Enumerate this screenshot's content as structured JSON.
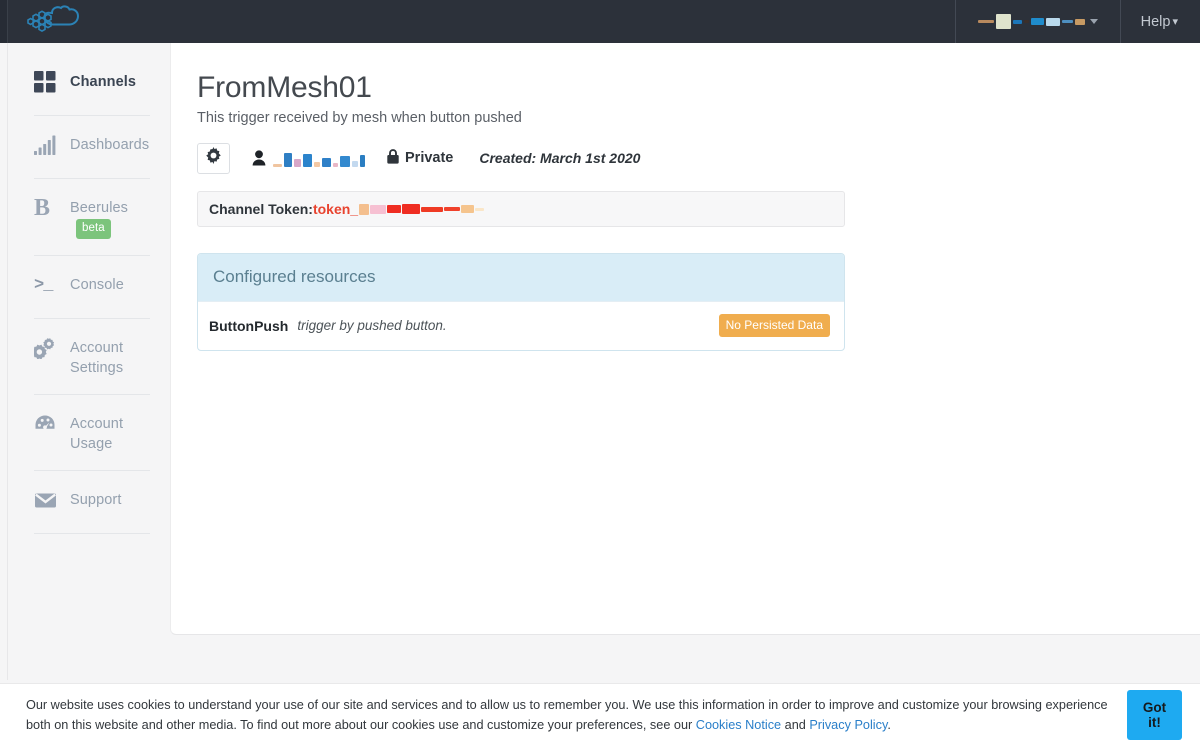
{
  "navbar": {
    "logo_name": "cloud-molecule-logo",
    "user_menu": {
      "label_redacted": true,
      "caret_icon": "chevron-down-icon"
    },
    "help_label": "Help",
    "help_caret": "▾"
  },
  "sidebar": {
    "items": [
      {
        "id": "channels",
        "label": "Channels",
        "icon": "grid-icon",
        "active": true,
        "badge": ""
      },
      {
        "id": "dashboards",
        "label": "Dashboards",
        "icon": "bar-chart-icon",
        "active": false,
        "badge": ""
      },
      {
        "id": "beerules",
        "label": "Beerules",
        "icon": "letter-b-icon",
        "active": false,
        "badge": "beta"
      },
      {
        "id": "console",
        "label": "Console",
        "icon": "terminal-icon",
        "active": false,
        "badge": ""
      },
      {
        "id": "account-settings",
        "label": "Account Settings",
        "icon": "gears-icon",
        "active": false,
        "badge": ""
      },
      {
        "id": "account-usage",
        "label": "Account Usage",
        "icon": "gauge-icon",
        "active": false,
        "badge": ""
      },
      {
        "id": "support",
        "label": "Support",
        "icon": "envelope-icon",
        "active": false,
        "badge": ""
      }
    ]
  },
  "main": {
    "title": "FromMesh01",
    "subtitle": "This trigger received by mesh when button pushed",
    "settings_icon": "gear-icon",
    "owner_icon": "person-icon",
    "owner_name_redacted": true,
    "privacy_icon": "lock-icon",
    "privacy_label": "Private",
    "created_label": "Created: March 1st 2020",
    "token": {
      "label": "Channel Token:",
      "prefix": "token_",
      "value_redacted": true
    },
    "panel": {
      "header": "Configured resources",
      "rows": [
        {
          "name": "ButtonPush",
          "description": "trigger by pushed button.",
          "status_badge": "No Persisted Data"
        }
      ]
    }
  },
  "cookie_banner": {
    "text_part_1": "Our website uses cookies to understand your use of our site and services and to allow us to remember you. We use this information in order to improve and customize your browsing experience both on this website and other media. To find out more about our cookies use and customize your preferences, see our ",
    "link_cookies": "Cookies Notice",
    "text_and": " and ",
    "link_privacy": "Privacy Policy",
    "text_end": ".",
    "accept_label": "Got it!"
  },
  "colors": {
    "navbar_bg": "#2c313a",
    "sidebar_bg": "#f5f5f6",
    "panel_header_bg": "#d9edf7",
    "badge_beta": "#7cc47c",
    "badge_warn": "#f0ad4e",
    "token_accent": "#e8432f",
    "link_blue": "#2a7fc9",
    "cookie_button": "#1eaaf1"
  }
}
